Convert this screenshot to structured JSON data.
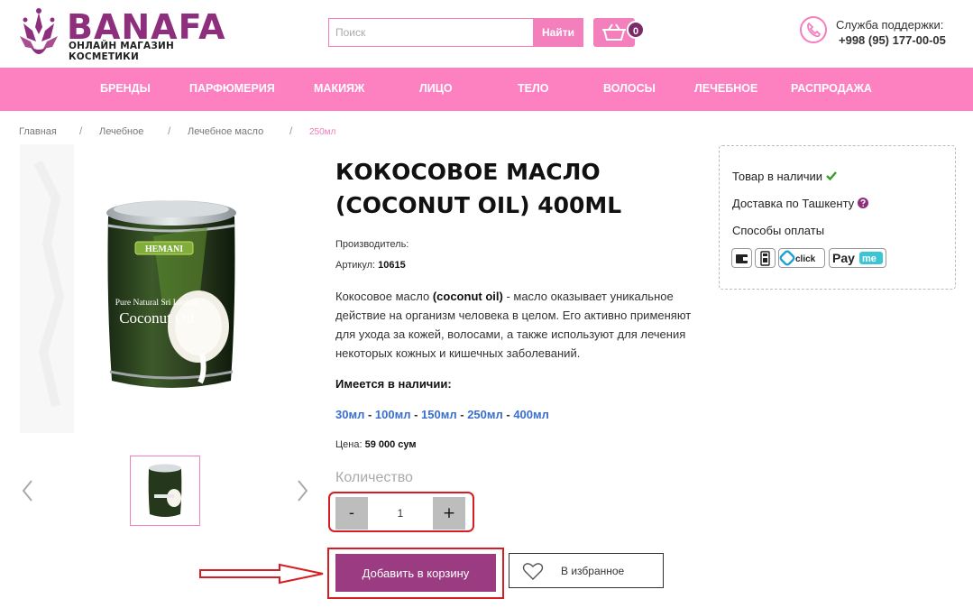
{
  "header": {
    "brand": "BANAFA",
    "tagline": "ОНЛАЙН МАГАЗИН КОСМЕТИКИ",
    "search_placeholder": "Поиск",
    "search_button": "Найти",
    "cart_count": "0",
    "support_label": "Служба поддержки:",
    "support_phone": "+998 (95) 177-00-05"
  },
  "nav": {
    "items": [
      "БРЕНДЫ",
      "ПАРФЮМЕРИЯ",
      "МАКИЯЖ",
      "ЛИЦО",
      "ТЕЛО",
      "ВОЛОСЫ",
      "ЛЕЧЕБНОЕ",
      "РАСПРОДАЖА"
    ]
  },
  "breadcrumb": {
    "items": [
      "Главная",
      "Лечебное",
      "Лечебное масло",
      "250мл"
    ],
    "separator": "/"
  },
  "product": {
    "title": "КОКОСОВОЕ МАСЛО (COCONUT OIL) 400ML",
    "manufacturer_label": "Производитель:",
    "article_label": "Артикул:",
    "article_value": "10615",
    "desc_bold": "(coconut oil)",
    "desc_prefix": "Кокосовое масло ",
    "desc_rest": " - масло оказывает уникальное действие на организм человека в целом. Его активно применяют для ухода за кожей, волосами, а также используют для лечения некоторых кожных и кишечных заболеваний.",
    "availability_label": "Имеется в наличии:",
    "sizes": [
      "30мл",
      "100мл",
      "150мл",
      "250мл",
      "400мл"
    ],
    "size_separator": " - ",
    "price_label": "Цена:",
    "price_value": "59 000 сум",
    "quantity_label": "Количество",
    "quantity_minus": "-",
    "quantity_value": "1",
    "quantity_plus": "+",
    "add_to_cart": "Добавить в корзину",
    "favorite": "В избранное",
    "image_label_brand": "HEMANI",
    "image_label_line1": "Pure Natural Sri Lankan",
    "image_label_line2": "Coconut Oil"
  },
  "info": {
    "in_stock": "Товар в наличии",
    "delivery": "Доставка по Ташкенту",
    "payment_methods": "Способы оплаты",
    "payments": [
      "click",
      "Pay",
      "me"
    ]
  },
  "colors": {
    "brand_purple": "#8e2f7d",
    "accent_pink": "#fd80c1",
    "button_purple": "#9b3c82",
    "highlight_red": "#d71d24",
    "link_blue": "#3a6fd0"
  }
}
